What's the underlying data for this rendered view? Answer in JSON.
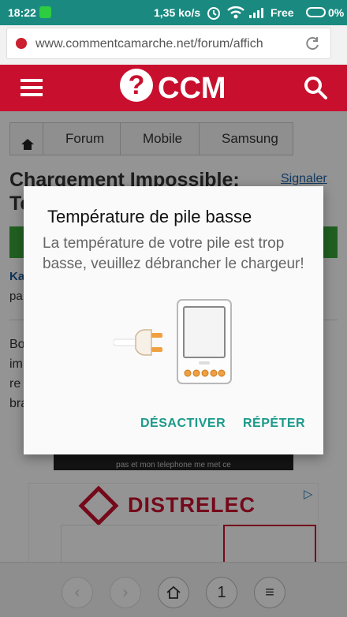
{
  "status_bar": {
    "time": "18:22",
    "speed": "1,35 ko/s",
    "carrier": "Free",
    "battery": "0%"
  },
  "browser": {
    "url": "www.commentcamarche.net/forum/affich"
  },
  "site": {
    "logo": "CCM",
    "logo_mark": "?"
  },
  "breadcrumb": [
    "Forum",
    "Mobile",
    "Samsung"
  ],
  "page": {
    "title": "Chargement Impossible:",
    "title_line2": "Te",
    "report_link": "Signaler",
    "author": "Ka",
    "author_sub": "pa",
    "body_lines": [
      "Bo",
      "im",
      "re",
      "bra"
    ],
    "video_caption": "pas et mon telephone me met ce"
  },
  "ad": {
    "brand": "DISTRELEC",
    "choice_mark": "▷"
  },
  "bottom_nav": {
    "back": "‹",
    "forward": "›",
    "tabs_count": "1",
    "menu": "≡"
  },
  "dialog": {
    "title": "Température de pile basse",
    "message": "La température de votre pile est trop basse, veuillez débrancher le chargeur!",
    "disable_label": "DÉSACTIVER",
    "repeat_label": "RÉPÉTER"
  },
  "colors": {
    "status_bar": "#1a8a80",
    "brand_red": "#c8102e",
    "dialog_accent": "#1a9a8a"
  }
}
